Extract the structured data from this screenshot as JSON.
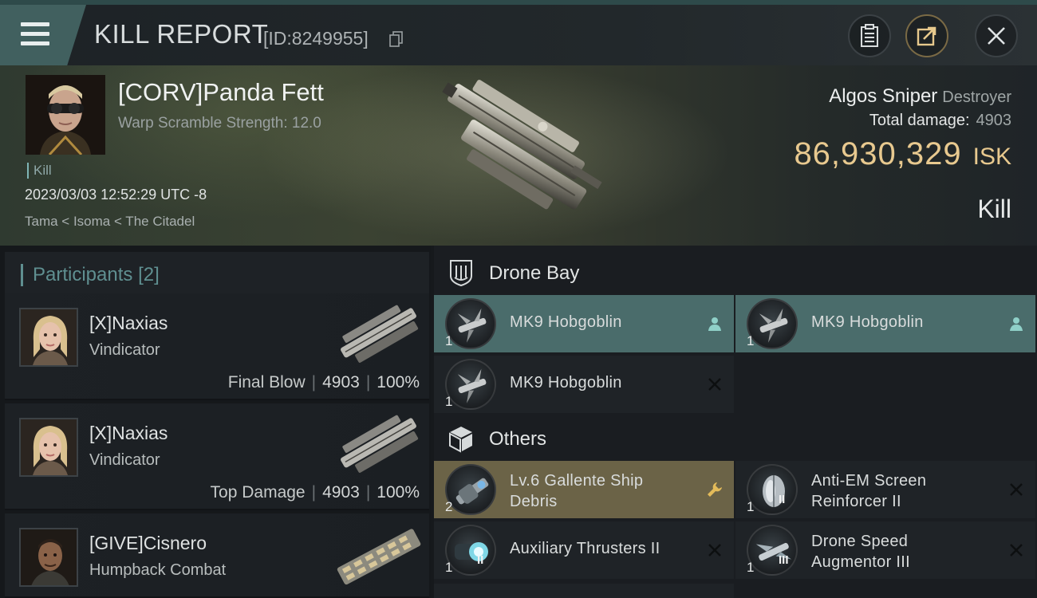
{
  "header": {
    "title": "KILL REPORT",
    "report_id": "[ID:8249955]"
  },
  "victim": {
    "pilot_name": "[CORV]Panda Fett",
    "warp_scramble": "Warp Scramble Strength: 12.0",
    "kill_tag": "Kill",
    "timestamp": "2023/03/03 12:52:29 UTC -8",
    "location": "Tama < Isoma < The Citadel",
    "ship_name": "Algos Sniper",
    "ship_class": "Destroyer",
    "total_damage_label": "Total damage:",
    "total_damage": "4903",
    "isk_value": "86,930,329",
    "isk_unit": "ISK",
    "result": "Kill"
  },
  "participants": {
    "label": "Participants",
    "count": "[2]",
    "items": [
      {
        "name": "[X]Naxias",
        "ship": "Vindicator",
        "role": "Final Blow",
        "damage": "4903",
        "percent": "100%"
      },
      {
        "name": "[X]Naxias",
        "ship": "Vindicator",
        "role": "Top Damage",
        "damage": "4903",
        "percent": "100%"
      },
      {
        "name": "[GIVE]Cisnero",
        "ship": "Humpback Combat"
      }
    ]
  },
  "drone_bay": {
    "title": "Drone Bay",
    "items": [
      {
        "qty": "1",
        "name": "MK9  Hobgoblin",
        "status": "person-icon",
        "color": "#4a6c6b"
      },
      {
        "qty": "1",
        "name": "MK9  Hobgoblin",
        "status": "person-icon",
        "color": "#4a6c6b"
      },
      {
        "qty": "1",
        "name": "MK9  Hobgoblin",
        "status": "destroyed-x-icon"
      }
    ]
  },
  "others": {
    "title": "Others",
    "items": [
      {
        "qty": "2",
        "name": "Lv.6 Gallente Ship Debris",
        "status": "wrench-icon",
        "color": "#6b6347"
      },
      {
        "qty": "1",
        "name": "Anti-EM Screen Reinforcer II",
        "tier": "II",
        "status": "destroyed-x-icon"
      },
      {
        "qty": "1",
        "name": "Auxiliary Thrusters II",
        "tier": "II",
        "status": "destroyed-x-icon"
      },
      {
        "qty": "1",
        "name": "Drone Speed Augmentor III",
        "tier": "III",
        "status": "destroyed-x-icon"
      }
    ]
  },
  "colors": {
    "accent_teal": "#5f8f90",
    "isk_gold": "#e8c98f",
    "teal_row": "#4a6c6b",
    "gold_row": "#6b6347"
  }
}
